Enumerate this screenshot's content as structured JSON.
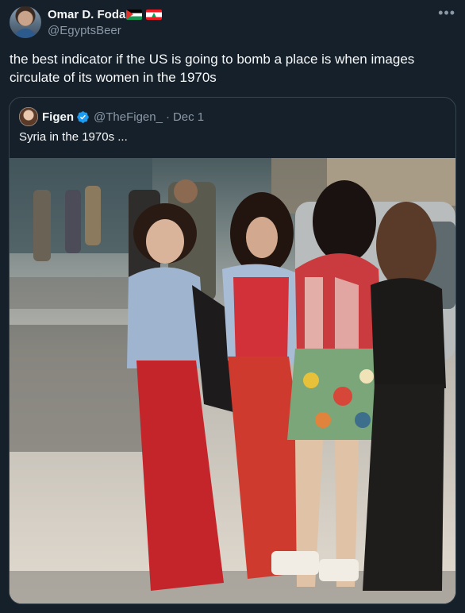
{
  "post": {
    "author_name": "Omar D. Foda",
    "author_handle": "@EgyptsBeer",
    "more_icon": "•••",
    "flags": [
      "palestine-flag",
      "lebanon-flag"
    ],
    "text": "the best indicator if the US is going to bomb a place is when images circulate of its women in the 1970s"
  },
  "quoted_post": {
    "author_name": "Figen",
    "author_handle": "@TheFigen_",
    "separator": "·",
    "date": "Dec 1",
    "verified": true,
    "text": "Syria in the 1970s ...",
    "photo": {
      "subject": "women-street-photo"
    }
  },
  "colors": {
    "background": "#15202b",
    "text_primary": "#f7f9f9",
    "text_secondary": "#8b98a5",
    "border": "#38444d",
    "verified_blue": "#1d9bf0"
  }
}
